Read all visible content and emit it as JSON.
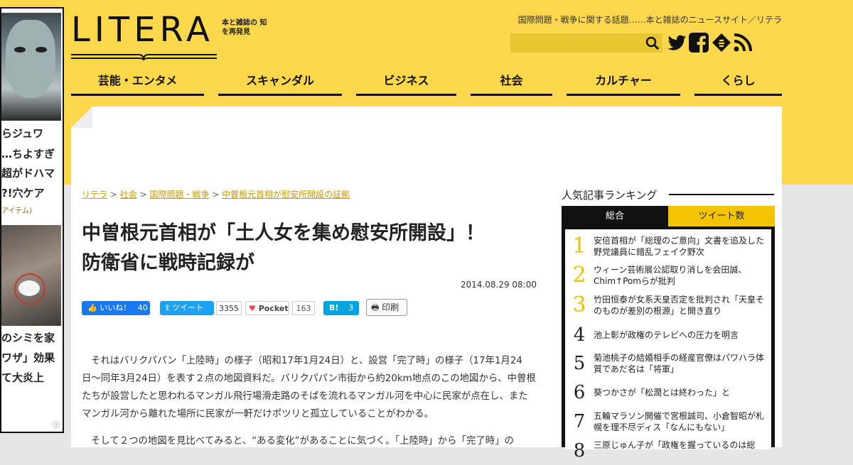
{
  "ad": {
    "lines1": [
      "らジュワ",
      "ちよすぎ…",
      "超がドハマ",
      "穴ケア!?"
    ],
    "label1": "アイテム)",
    "lines2": [
      "のシミを家",
      "ワザ」効果",
      "て大炎上"
    ],
    "info_icon": "info-icon"
  },
  "header": {
    "logo": "LITERA",
    "logo_sub": "本と雑誌の 知を再発見",
    "tagline": "国際問題・戦争に関する話題……本と雑誌のニュースサイト／リテラ",
    "search_placeholder": "",
    "social": [
      "twitter-icon",
      "facebook-icon",
      "feedly-icon",
      "rss-icon"
    ]
  },
  "nav": [
    "芸能・エンタメ",
    "スキャンダル",
    "ビジネス",
    "社会",
    "カルチャー",
    "くらし"
  ],
  "breadcrumb": [
    "リテラ",
    "社会",
    "国際問題・戦争",
    "中曽根元首相が慰安所開設の証拠"
  ],
  "article": {
    "title_line1": "中曽根元首相が「土人女を集め慰安所開設」！",
    "title_line2": "防衛省に戦時記録が",
    "date": "2014.08.29 08:00",
    "share": {
      "fb_label": "いいね！",
      "fb_count": "40",
      "tw_label": "ツイート",
      "tw_count": "3355",
      "pocket_label": "Pocket",
      "pocket_count": "163",
      "hatena_label": "B!",
      "hatena_count": "3",
      "print_label": "印刷"
    },
    "paragraph1": "それはバリクパパン「上陸時」の様子（昭和17年1月24日）と、設営「完了時」の様子（17年1月24日〜同年3月24日）を表す２点の地図資料だ。バリクパパン市街から約20km地点のこの地図から、中曽根たちが設営したと思われるマンガル飛行場滑走路のそばを流れるマンガル河を中心に民家が点在し、またマンガル河から離れた場所に民家が一軒だけポツリと孤立していることがわかる。",
    "paragraph2": "そして２つの地図を見比べてみると、“ある変化”があることに気づく。「上陸時」から「完了時」の"
  },
  "ranking": {
    "heading": "人気記事ランキング",
    "tab_all": "総合",
    "tab_tweet": "ツイート数",
    "items": [
      {
        "rank": "1",
        "title": "安倍首相が「総理のご意向」文書を追及した野党議員に錯乱フェイク野次"
      },
      {
        "rank": "2",
        "title": "ウィーン芸術展公認取り消しを会田誠、Chim↑Pomらが批判"
      },
      {
        "rank": "3",
        "title": "竹田恒泰が女系天皇否定を批判され「天皇そのものが差別の根源」と開き直り"
      },
      {
        "rank": "4",
        "title": "池上彰が政権のテレビへの圧力を明言"
      },
      {
        "rank": "5",
        "title": "菊池桃子の結婚相手の経産官僚はパワハラ体質であだ名は「将軍」"
      },
      {
        "rank": "6",
        "title": "葵つかさが「松潤とは終わった」と"
      },
      {
        "rank": "7",
        "title": "五輪マラソン開催で宮根誠司、小倉智昭が札幌を理不尽ディス「なんにもない」"
      },
      {
        "rank": "8",
        "title": "三原じゅん子が「政権を握っているのは総"
      }
    ]
  },
  "colors": {
    "brand_yellow": "#fdd84d",
    "link": "#c79a00",
    "facebook": "#1877f2",
    "twitter": "#1da1f2",
    "hatena": "#00a4de"
  }
}
